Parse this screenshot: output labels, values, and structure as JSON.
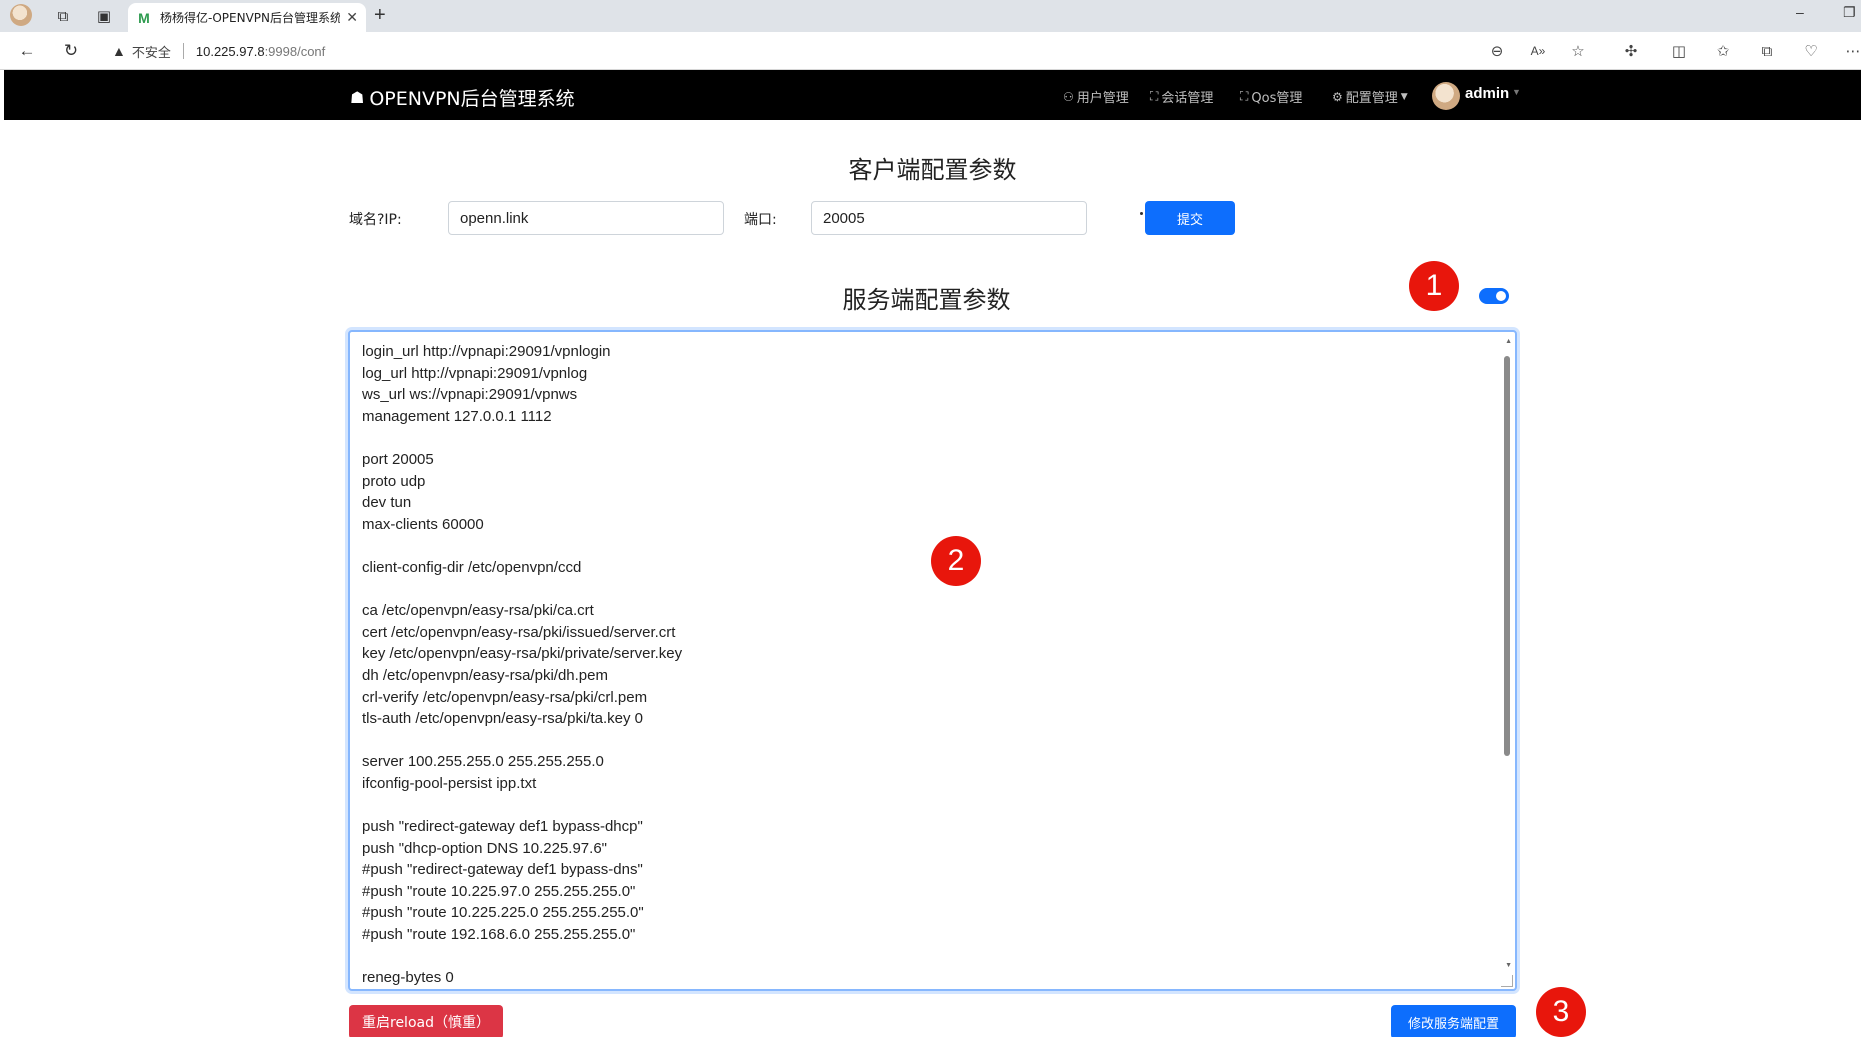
{
  "browser": {
    "tab_title": "杨杨得亿-OPENVPN后台管理系统",
    "tab_favicon": "M",
    "new_tab": "+",
    "security_label": "不安全",
    "url_host": "10.225.97.8",
    "url_path": ":9998/conf"
  },
  "navbar": {
    "brand": "OPENVPN后台管理系统",
    "menu": {
      "users": "用户管理",
      "sessions": "会话管理",
      "qos": "Qos管理",
      "config": "配置管理"
    },
    "user": "admin"
  },
  "client": {
    "title": "客户端配置参数",
    "domain_label": "域名?IP:",
    "domain_value": "openn.link",
    "port_label": "端口:",
    "port_value": "20005",
    "submit": "提交"
  },
  "server": {
    "title": "服务端配置参数",
    "toggle_on": true,
    "config": "login_url http://vpnapi:29091/vpnlogin\nlog_url http://vpnapi:29091/vpnlog\nws_url ws://vpnapi:29091/vpnws\nmanagement 127.0.0.1 1112\n\nport 20005\nproto udp\ndev tun\nmax-clients 60000\n\nclient-config-dir /etc/openvpn/ccd\n\nca /etc/openvpn/easy-rsa/pki/ca.crt\ncert /etc/openvpn/easy-rsa/pki/issued/server.crt\nkey /etc/openvpn/easy-rsa/pki/private/server.key\ndh /etc/openvpn/easy-rsa/pki/dh.pem\ncrl-verify /etc/openvpn/easy-rsa/pki/crl.pem\ntls-auth /etc/openvpn/easy-rsa/pki/ta.key 0\n\nserver 100.255.255.0 255.255.255.0\nifconfig-pool-persist ipp.txt\n\npush \"redirect-gateway def1 bypass-dhcp\"\npush \"dhcp-option DNS 10.225.97.6\"\n#push \"redirect-gateway def1 bypass-dns\"\n#push \"route 10.225.97.0 255.255.255.0\"\n#push \"route 10.225.225.0 255.255.255.0\"\n#push \"route 192.168.6.0 255.255.255.0\"\n\nreneg-bytes 0",
    "reload_button": "重启reload（慎重）",
    "save_button": "修改服务端配置"
  },
  "annotations": {
    "marker_1": "1",
    "marker_2": "2",
    "marker_3": "3"
  },
  "colors": {
    "primary": "#0d6efd",
    "danger": "#dc3545",
    "marker": "#e8160c",
    "navbar": "#000000"
  }
}
